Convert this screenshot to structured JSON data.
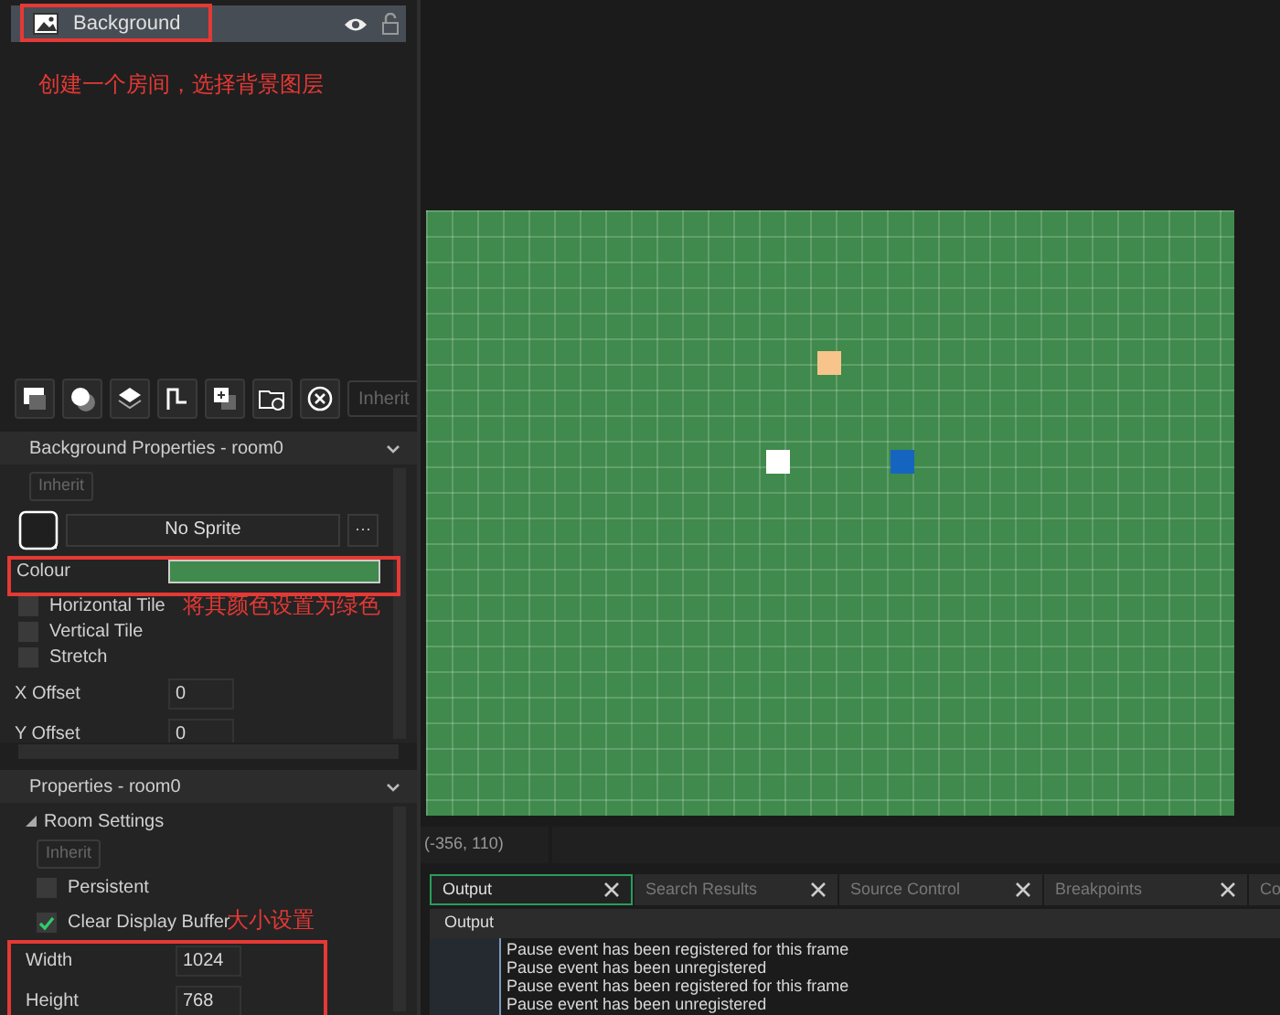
{
  "layers": [
    {
      "name": "Background",
      "selected": true
    }
  ],
  "annotations": [
    {
      "text": "创建一个房间，选择背景图层"
    },
    {
      "text": "将其颜色设置为绿色"
    },
    {
      "text": "大小设置"
    }
  ],
  "layer_toolbar": {
    "inherit_button": "Inherit"
  },
  "background_properties": {
    "title": "Background Properties - room0",
    "inherit_button": "Inherit",
    "sprite": "No Sprite",
    "sprite_menu": "···",
    "colour_label": "Colour",
    "color": "#3f8a4c",
    "options": [
      {
        "label": "Horizontal Tile",
        "checked": false
      },
      {
        "label": "Vertical Tile",
        "checked": false
      },
      {
        "label": "Stretch",
        "checked": false
      }
    ],
    "fields": [
      {
        "label": "X Offset",
        "value": "0"
      },
      {
        "label": "Y Offset",
        "value": "0"
      }
    ]
  },
  "properties": {
    "title": "Properties - room0",
    "section": "Room Settings",
    "expanded": true,
    "inherit_button": "Inherit",
    "options": [
      {
        "label": "Persistent",
        "checked": false
      },
      {
        "label": "Clear Display Buffer",
        "checked": true
      }
    ],
    "fields": [
      {
        "label": "Width",
        "value": "1024"
      },
      {
        "label": "Height",
        "value": "768"
      }
    ]
  },
  "room": {
    "instances": [
      {
        "color": "#f7c48c"
      },
      {
        "color": "#ffffff"
      },
      {
        "color": "#1565c0"
      }
    ]
  },
  "status_bar": {
    "coordinates": "(-356, 110)"
  },
  "output": {
    "tabs": [
      {
        "label": "Output",
        "selected": true
      },
      {
        "label": "Search Results",
        "selected": false
      },
      {
        "label": "Source Control",
        "selected": false
      },
      {
        "label": "Breakpoints",
        "selected": false
      },
      {
        "label": "Co",
        "selected": false
      }
    ],
    "header": "Output",
    "lines": [
      "Pause event has been registered for this frame",
      "Pause event has been unregistered",
      "Pause event has been registered for this frame",
      "Pause event has been unregistered"
    ]
  }
}
